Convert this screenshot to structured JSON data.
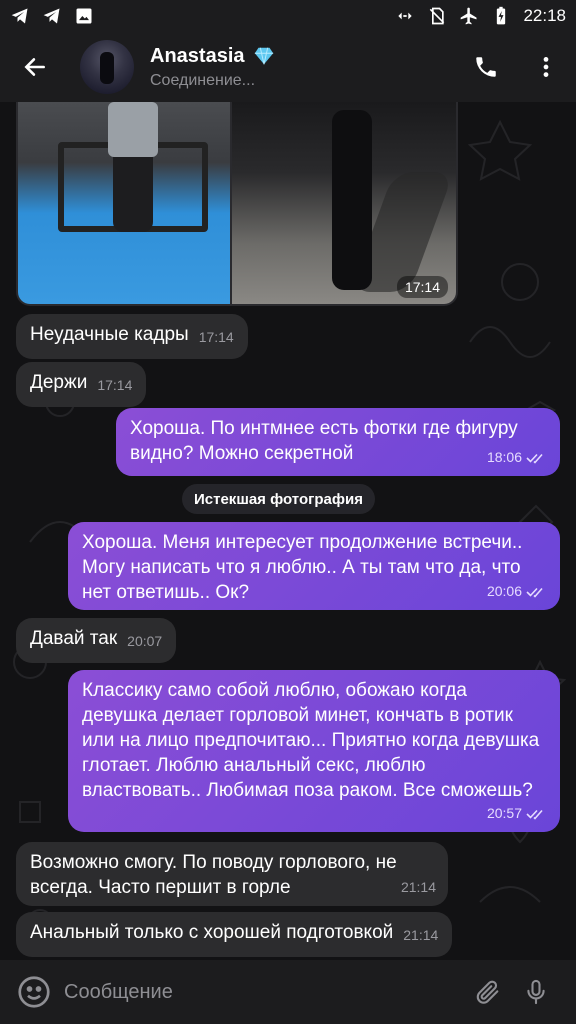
{
  "status_bar": {
    "left_icons": [
      "telegram-icon",
      "telegram-icon",
      "gallery-icon"
    ],
    "right_icons": [
      "data-saver-icon",
      "no-sim-icon",
      "airplane-icon",
      "battery-charging-icon"
    ],
    "time": "22:18"
  },
  "header": {
    "name": "Anastasia",
    "status": "Соединение...",
    "badge_icon": "gem-icon"
  },
  "chat": {
    "photo_time": "17:14",
    "messages": [
      {
        "text": "Неудачные кадры",
        "time": "17:14"
      },
      {
        "text": "Держи",
        "time": "17:14"
      },
      {
        "text": "Хороша. По интмнее есть фотки где фигуру видно? Можно секретной",
        "time": "18:06"
      },
      {
        "text": "Хороша. Меня интересует продолжение встречи.. Могу написать что я люблю.. А ты там что да, что нет ответишь.. Ок?",
        "time": "20:06"
      },
      {
        "text": "Давай так",
        "time": "20:07"
      },
      {
        "text": "Классику само собой люблю, обожаю когда девушка делает горловой минет, кончать в ротик или на лицо предпочитаю... Приятно когда девушка глотает. Люблю анальный секс, люблю властвовать.. Любимая поза раком. Все сможешь?",
        "time": "20:57"
      },
      {
        "text": "Возможно смогу. По поводу горлового, не всегда. Часто першит в горле",
        "time": "21:14"
      },
      {
        "text": "Анальный только с хорошей подготовкой",
        "time": "21:14"
      }
    ],
    "expiring_label": "Истекшая фотография"
  },
  "input": {
    "placeholder": "Сообщение"
  },
  "colors": {
    "outgoing_bubble": "#7b4ad8",
    "incoming_bubble": "#2c2c2e",
    "background": "#121214",
    "header": "#1c1c1e"
  }
}
